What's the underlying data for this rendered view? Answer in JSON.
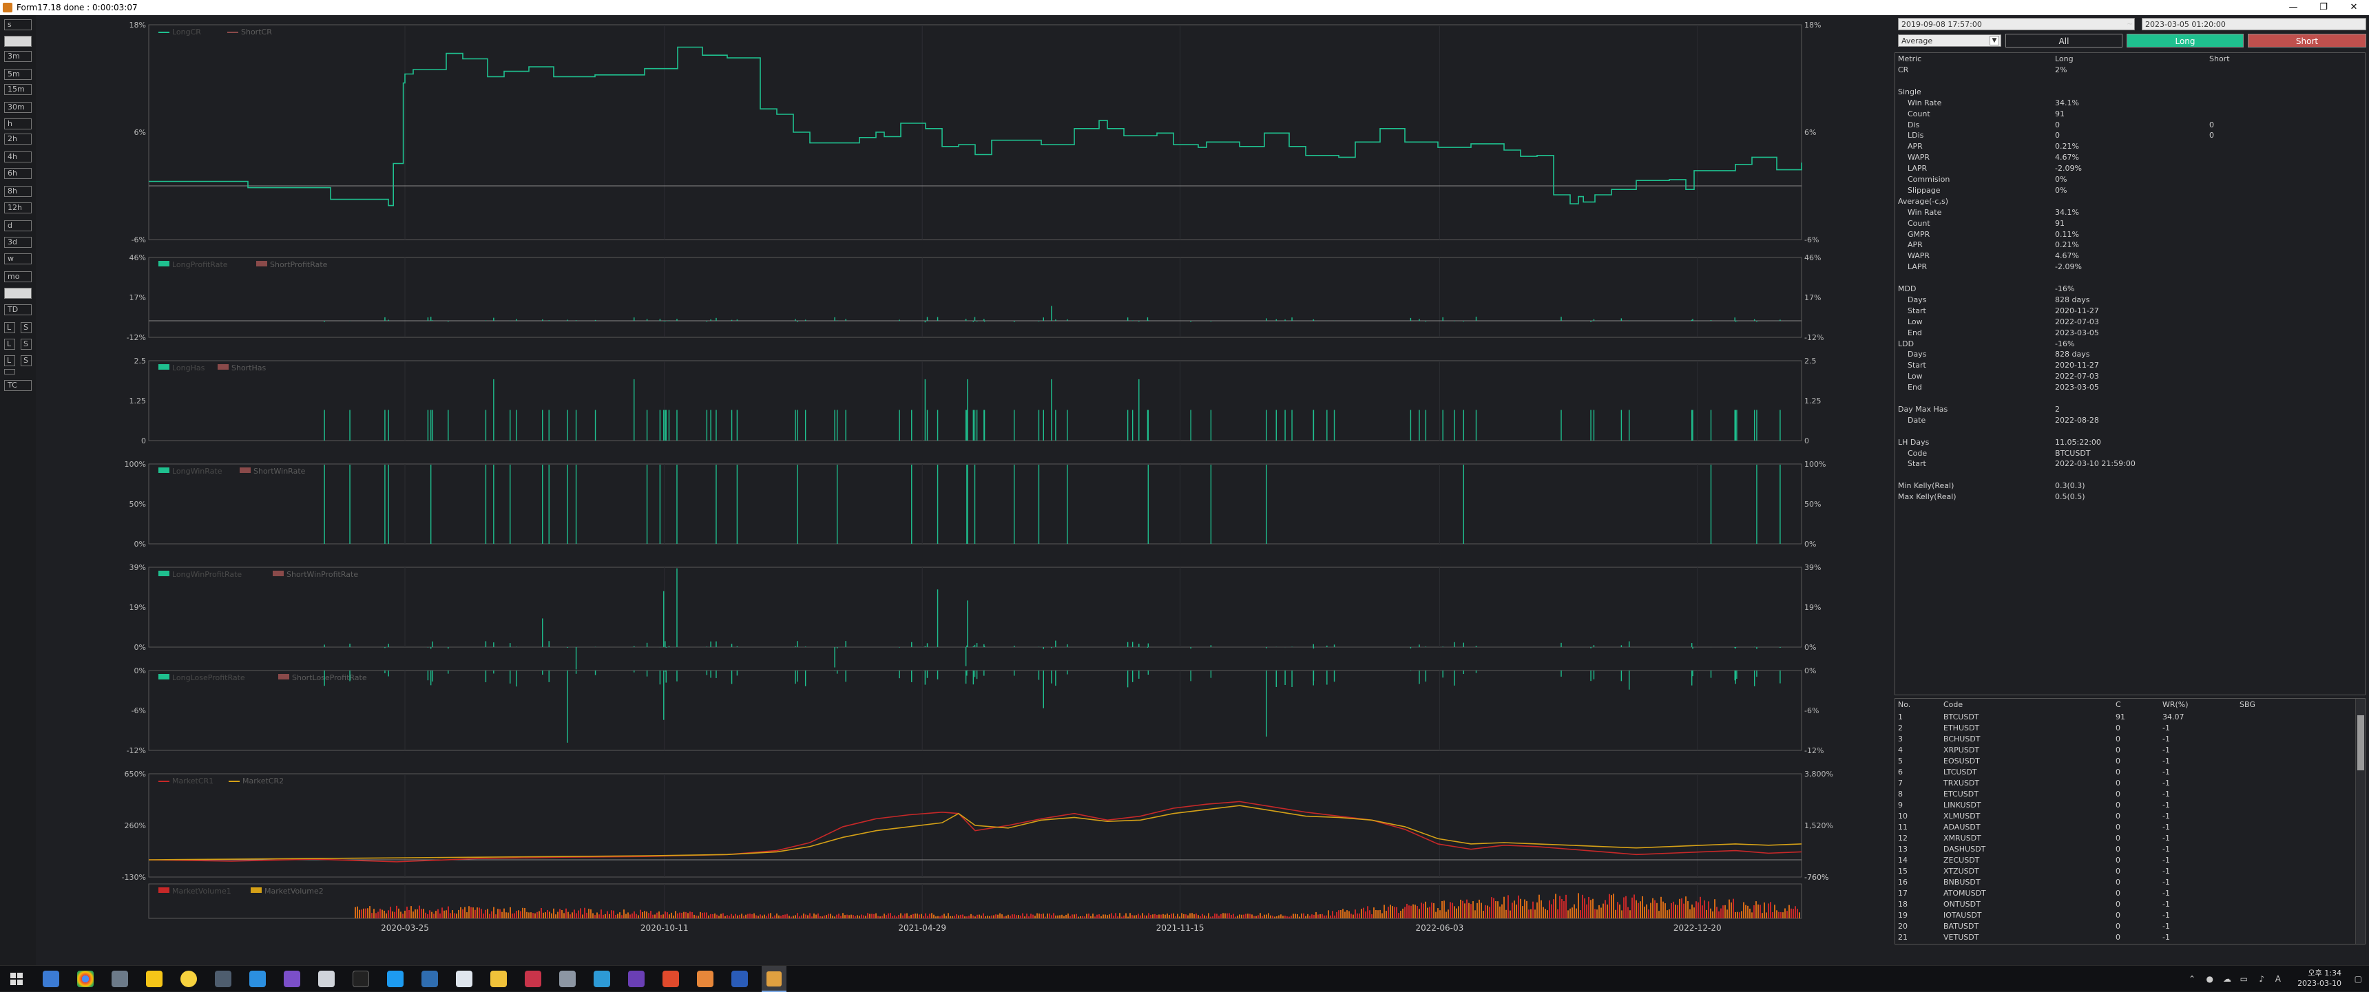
{
  "window": {
    "title": "Form17.18 done : 0:00:03:07",
    "controls": [
      "—",
      "❐",
      "✕"
    ]
  },
  "timeframes": [
    "s",
    "",
    "3m",
    "5m",
    "15m",
    "30m",
    "h",
    "2h",
    "4h",
    "6h",
    "8h",
    "12h",
    "d",
    "3d",
    "w",
    "mo",
    "",
    "TD",
    "L",
    "S",
    "L",
    "S",
    "L",
    "S",
    "",
    "TC"
  ],
  "controls": {
    "date_start": "2019-09-08 17:57:00",
    "date_sep": "~",
    "date_end": "2023-03-05 01:20:00",
    "mode_select": "Average",
    "btn_all": "All",
    "btn_long": "Long",
    "btn_short": "Short",
    "colors": {
      "long": "#1fc08f",
      "short": "#c0504d"
    }
  },
  "metrics": {
    "header": {
      "metric": "Metric",
      "long": "Long",
      "short": "Short"
    },
    "rows": [
      {
        "m": "CR",
        "l": "2%",
        "s": "",
        "indent": 0
      },
      {
        "m": "",
        "l": "",
        "s": "",
        "indent": 0
      },
      {
        "m": "Single",
        "l": "",
        "s": "",
        "indent": 0
      },
      {
        "m": "Win Rate",
        "l": "34.1%",
        "s": "",
        "indent": 1
      },
      {
        "m": "Count",
        "l": "91",
        "s": "",
        "indent": 1
      },
      {
        "m": "Dis",
        "l": "0",
        "s": "0",
        "indent": 1
      },
      {
        "m": "LDis",
        "l": "0",
        "s": "0",
        "indent": 1
      },
      {
        "m": "APR",
        "l": "0.21%",
        "s": "",
        "indent": 1
      },
      {
        "m": "WAPR",
        "l": "4.67%",
        "s": "",
        "indent": 1
      },
      {
        "m": "LAPR",
        "l": "-2.09%",
        "s": "",
        "indent": 1
      },
      {
        "m": "Commision",
        "l": "0%",
        "s": "",
        "indent": 1
      },
      {
        "m": "Slippage",
        "l": "0%",
        "s": "",
        "indent": 1
      },
      {
        "m": "Average(-c,s)",
        "l": "",
        "s": "",
        "indent": 0
      },
      {
        "m": "Win Rate",
        "l": "34.1%",
        "s": "",
        "indent": 1
      },
      {
        "m": "Count",
        "l": "91",
        "s": "",
        "indent": 1
      },
      {
        "m": "GMPR",
        "l": "0.11%",
        "s": "",
        "indent": 1
      },
      {
        "m": "APR",
        "l": "0.21%",
        "s": "",
        "indent": 1
      },
      {
        "m": "WAPR",
        "l": "4.67%",
        "s": "",
        "indent": 1
      },
      {
        "m": "LAPR",
        "l": "-2.09%",
        "s": "",
        "indent": 1
      },
      {
        "m": "",
        "l": "",
        "s": "",
        "indent": 0
      },
      {
        "m": "MDD",
        "l": "-16%",
        "s": "",
        "indent": 0
      },
      {
        "m": "Days",
        "l": "828 days",
        "s": "",
        "indent": 1
      },
      {
        "m": "Start",
        "l": "2020-11-27",
        "s": "",
        "indent": 1
      },
      {
        "m": "Low",
        "l": "2022-07-03",
        "s": "",
        "indent": 1
      },
      {
        "m": "End",
        "l": "2023-03-05",
        "s": "",
        "indent": 1
      },
      {
        "m": "LDD",
        "l": "-16%",
        "s": "",
        "indent": 0
      },
      {
        "m": "Days",
        "l": "828 days",
        "s": "",
        "indent": 1
      },
      {
        "m": "Start",
        "l": "2020-11-27",
        "s": "",
        "indent": 1
      },
      {
        "m": "Low",
        "l": "2022-07-03",
        "s": "",
        "indent": 1
      },
      {
        "m": "End",
        "l": "2023-03-05",
        "s": "",
        "indent": 1
      },
      {
        "m": "",
        "l": "",
        "s": "",
        "indent": 0
      },
      {
        "m": "Day Max Has",
        "l": "2",
        "s": "",
        "indent": 0
      },
      {
        "m": "Date",
        "l": "2022-08-28",
        "s": "",
        "indent": 1
      },
      {
        "m": "",
        "l": "",
        "s": "",
        "indent": 0
      },
      {
        "m": "LH Days",
        "l": "11.05:22:00",
        "s": "",
        "indent": 0
      },
      {
        "m": "Code",
        "l": "BTCUSDT",
        "s": "",
        "indent": 1
      },
      {
        "m": "Start",
        "l": "2022-03-10 21:59:00",
        "s": "",
        "indent": 1
      },
      {
        "m": "",
        "l": "",
        "s": "",
        "indent": 0
      },
      {
        "m": "Min Kelly(Real)",
        "l": "0.3(0.3)",
        "s": "",
        "indent": 0
      },
      {
        "m": "Max Kelly(Real)",
        "l": "0.5(0.5)",
        "s": "",
        "indent": 0
      }
    ]
  },
  "symbols": {
    "header": {
      "no": "No.",
      "code": "Code",
      "c": "C",
      "wr": "WR(%)",
      "sbg": "SBG"
    },
    "rows": [
      {
        "no": "1",
        "code": "BTCUSDT",
        "c": "91",
        "wr": "34.07"
      },
      {
        "no": "2",
        "code": "ETHUSDT",
        "c": "0",
        "wr": "-1"
      },
      {
        "no": "3",
        "code": "BCHUSDT",
        "c": "0",
        "wr": "-1"
      },
      {
        "no": "4",
        "code": "XRPUSDT",
        "c": "0",
        "wr": "-1"
      },
      {
        "no": "5",
        "code": "EOSUSDT",
        "c": "0",
        "wr": "-1"
      },
      {
        "no": "6",
        "code": "LTCUSDT",
        "c": "0",
        "wr": "-1"
      },
      {
        "no": "7",
        "code": "TRXUSDT",
        "c": "0",
        "wr": "-1"
      },
      {
        "no": "8",
        "code": "ETCUSDT",
        "c": "0",
        "wr": "-1"
      },
      {
        "no": "9",
        "code": "LINKUSDT",
        "c": "0",
        "wr": "-1"
      },
      {
        "no": "10",
        "code": "XLMUSDT",
        "c": "0",
        "wr": "-1"
      },
      {
        "no": "11",
        "code": "ADAUSDT",
        "c": "0",
        "wr": "-1"
      },
      {
        "no": "12",
        "code": "XMRUSDT",
        "c": "0",
        "wr": "-1"
      },
      {
        "no": "13",
        "code": "DASHUSDT",
        "c": "0",
        "wr": "-1"
      },
      {
        "no": "14",
        "code": "ZECUSDT",
        "c": "0",
        "wr": "-1"
      },
      {
        "no": "15",
        "code": "XTZUSDT",
        "c": "0",
        "wr": "-1"
      },
      {
        "no": "16",
        "code": "BNBUSDT",
        "c": "0",
        "wr": "-1"
      },
      {
        "no": "17",
        "code": "ATOMUSDT",
        "c": "0",
        "wr": "-1"
      },
      {
        "no": "18",
        "code": "ONTUSDT",
        "c": "0",
        "wr": "-1"
      },
      {
        "no": "19",
        "code": "IOTAUSDT",
        "c": "0",
        "wr": "-1"
      },
      {
        "no": "20",
        "code": "BATUSDT",
        "c": "0",
        "wr": "-1"
      },
      {
        "no": "21",
        "code": "VETUSDT",
        "c": "0",
        "wr": "-1"
      }
    ]
  },
  "chart_data": {
    "type": "line",
    "x_dates": [
      "2019-09-08",
      "2023-03-05"
    ],
    "x_tick_labels": [
      "2020-03-25",
      "2020-10-11",
      "2021-04-29",
      "2021-11-15",
      "2022-06-03",
      "2022-12-20"
    ],
    "panels": [
      {
        "id": "cr",
        "type": "line",
        "left_ticks": [
          "18%",
          "6%",
          "-6%"
        ],
        "right_ticks": [
          "18%",
          "6%",
          "-6%"
        ],
        "ylim": [
          -6,
          18
        ],
        "legend": [
          "LongCR",
          "ShortCR"
        ],
        "series": [
          {
            "name": "LongCR",
            "x": [
              0,
              0.06,
              0.11,
              0.145,
              0.148,
              0.154,
              0.155,
              0.16,
              0.18,
              0.19,
              0.205,
              0.215,
              0.23,
              0.245,
              0.27,
              0.3,
              0.32,
              0.335,
              0.35,
              0.37,
              0.38,
              0.39,
              0.4,
              0.43,
              0.44,
              0.445,
              0.455,
              0.47,
              0.48,
              0.49,
              0.5,
              0.51,
              0.54,
              0.56,
              0.575,
              0.58,
              0.59,
              0.61,
              0.62,
              0.635,
              0.64,
              0.66,
              0.675,
              0.69,
              0.7,
              0.72,
              0.73,
              0.745,
              0.76,
              0.78,
              0.8,
              0.82,
              0.83,
              0.84,
              0.85,
              0.86,
              0.865,
              0.868,
              0.875,
              0.885,
              0.9,
              0.92,
              0.93,
              0.935,
              0.96,
              0.97,
              0.985,
              1.0
            ],
            "y": [
              0.5,
              -0.2,
              -1.5,
              -2.2,
              2.5,
              11.5,
              12.5,
              13,
              14.8,
              14.2,
              12.2,
              12.8,
              13.3,
              12.2,
              12.4,
              13.1,
              15.5,
              14.6,
              14.3,
              8.6,
              8.0,
              6.0,
              4.8,
              5.4,
              6.0,
              5.5,
              7.0,
              6.4,
              4.4,
              4.6,
              3.5,
              5.1,
              4.6,
              6.4,
              7.3,
              6.4,
              5.6,
              5.9,
              4.6,
              4.3,
              4.9,
              4.4,
              5.9,
              4.4,
              3.4,
              3.2,
              4.9,
              6.4,
              4.9,
              4.3,
              4.7,
              4.0,
              3.3,
              3.4,
              -1.0,
              -2.0,
              -1.2,
              -1.8,
              -1.0,
              -0.4,
              0.6,
              0.7,
              -0.4,
              1.7,
              2.4,
              3.2,
              1.8,
              2.6
            ]
          },
          {
            "name": "ShortCR",
            "x": [],
            "y": []
          }
        ]
      },
      {
        "id": "profit",
        "type": "bar",
        "left_ticks": [
          "46%",
          "17%",
          "-12%"
        ],
        "right_ticks": [
          "46%",
          "17%",
          "-12%"
        ],
        "ylim": [
          -12,
          46
        ],
        "legend": [
          "LongProfitRate",
          "ShortProfitRate"
        ]
      },
      {
        "id": "has",
        "type": "bar",
        "left_ticks": [
          "2.5",
          "1.25",
          "0"
        ],
        "right_ticks": [
          "2.5",
          "1.25",
          "0"
        ],
        "ylim": [
          0,
          2.5
        ],
        "legend": [
          "LongHas",
          "ShortHas"
        ]
      },
      {
        "id": "winrate",
        "type": "bar",
        "left_ticks": [
          "100%",
          "50%",
          "0%"
        ],
        "right_ticks": [
          "100%",
          "50%",
          "0%"
        ],
        "ylim": [
          0,
          100
        ],
        "legend": [
          "LongWinRate",
          "ShortWinRate"
        ]
      },
      {
        "id": "winprofit",
        "type": "bar",
        "left_ticks": [
          "39%",
          "19%",
          "0%"
        ],
        "right_ticks": [
          "39%",
          "19%",
          "0%"
        ],
        "ylim": [
          0,
          39
        ],
        "legend": [
          "LongWinProfitRate",
          "ShortWinProfitRate"
        ]
      },
      {
        "id": "loseprofit",
        "type": "bar",
        "left_ticks": [
          "0%",
          "-6%",
          "-12%"
        ],
        "right_ticks": [
          "0%",
          "-6%",
          "-12%"
        ],
        "ylim": [
          -12,
          0
        ],
        "legend": [
          "LongLoseProfitRate",
          "ShortLoseProfitRate"
        ]
      },
      {
        "id": "market",
        "type": "line",
        "left_ticks": [
          "650%",
          "260%",
          "-130%"
        ],
        "right_ticks": [
          "3,800%",
          "1,520%",
          "-760%"
        ],
        "ylim": [
          -130,
          650
        ],
        "legend": [
          "MarketCR1",
          "MarketCR2"
        ],
        "series": [
          {
            "name": "MarketCR1",
            "x": [
              0,
              0.05,
              0.1,
              0.15,
              0.2,
              0.25,
              0.3,
              0.35,
              0.38,
              0.4,
              0.42,
              0.44,
              0.46,
              0.48,
              0.49,
              0.5,
              0.52,
              0.54,
              0.56,
              0.58,
              0.6,
              0.62,
              0.64,
              0.66,
              0.68,
              0.7,
              0.72,
              0.74,
              0.76,
              0.78,
              0.8,
              0.82,
              0.84,
              0.86,
              0.88,
              0.9,
              0.92,
              0.94,
              0.96,
              0.98,
              1.0
            ],
            "y": [
              0,
              -10,
              5,
              -15,
              10,
              20,
              25,
              40,
              70,
              130,
              250,
              310,
              340,
              360,
              350,
              220,
              260,
              310,
              350,
              300,
              330,
              390,
              420,
              440,
              400,
              360,
              330,
              300,
              230,
              120,
              80,
              110,
              100,
              80,
              60,
              40,
              50,
              60,
              70,
              50,
              60
            ]
          },
          {
            "name": "MarketCR2",
            "x": [
              0,
              0.05,
              0.1,
              0.15,
              0.2,
              0.25,
              0.3,
              0.35,
              0.38,
              0.4,
              0.42,
              0.44,
              0.46,
              0.48,
              0.49,
              0.5,
              0.52,
              0.54,
              0.56,
              0.58,
              0.6,
              0.62,
              0.64,
              0.66,
              0.68,
              0.7,
              0.72,
              0.74,
              0.76,
              0.78,
              0.8,
              0.82,
              0.84,
              0.86,
              0.88,
              0.9,
              0.92,
              0.94,
              0.96,
              0.98,
              1.0
            ],
            "y": [
              0,
              5,
              10,
              15,
              20,
              25,
              30,
              40,
              60,
              100,
              170,
              220,
              250,
              280,
              350,
              260,
              240,
              300,
              320,
              290,
              300,
              350,
              380,
              410,
              370,
              330,
              320,
              300,
              250,
              160,
              120,
              130,
              120,
              110,
              100,
              90,
              100,
              110,
              120,
              110,
              120
            ]
          }
        ]
      },
      {
        "id": "volume",
        "type": "bar",
        "left_ticks": [],
        "right_ticks": [
          "-760%"
        ],
        "legend": [
          "MarketVolume1",
          "MarketVolume2"
        ]
      }
    ]
  }
}
